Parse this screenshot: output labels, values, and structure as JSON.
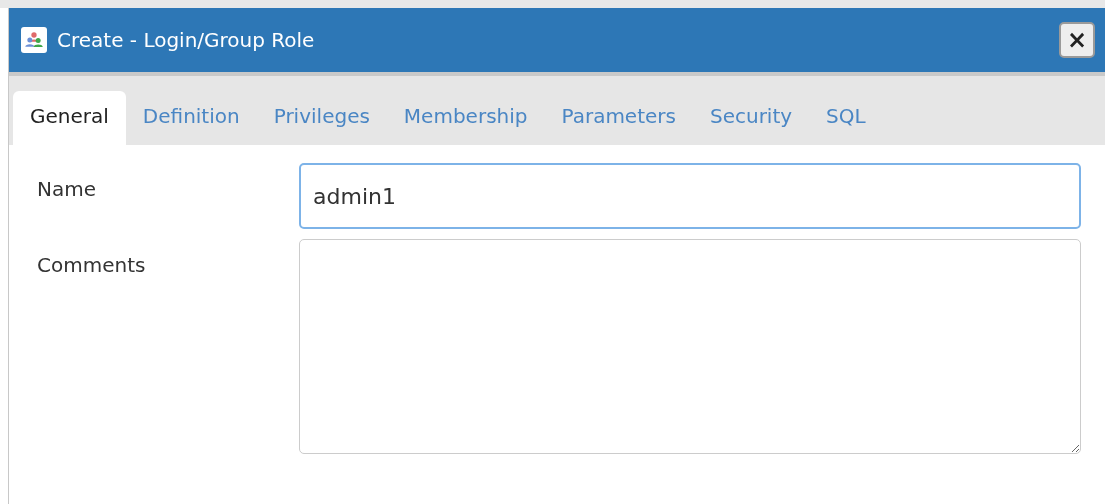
{
  "window": {
    "title": "Create - Login/Group Role",
    "close_label": "×"
  },
  "tabs": [
    {
      "label": "General",
      "selected": true
    },
    {
      "label": "Definition",
      "selected": false
    },
    {
      "label": "Privileges",
      "selected": false
    },
    {
      "label": "Membership",
      "selected": false
    },
    {
      "label": "Parameters",
      "selected": false
    },
    {
      "label": "Security",
      "selected": false
    },
    {
      "label": "SQL",
      "selected": false
    }
  ],
  "fields": [
    {
      "kind": "text",
      "label": "Name",
      "value": "admin1",
      "focused": true
    },
    {
      "kind": "textarea",
      "label": "Comments",
      "focused": false
    }
  ]
}
